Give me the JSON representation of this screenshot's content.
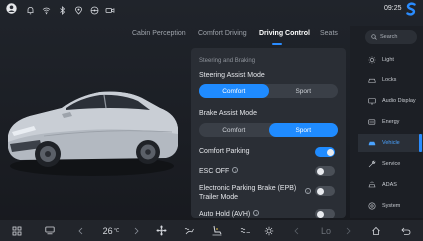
{
  "status": {
    "time": "09:25"
  },
  "tabs": [
    {
      "label": "Cabin Perception"
    },
    {
      "label": "Comfort Driving"
    },
    {
      "label": "Driving Control"
    },
    {
      "label": "Seats"
    }
  ],
  "panel": {
    "section": "Steering and Braking",
    "steering": {
      "label": "Steering Assist Mode",
      "options": [
        "Comfort",
        "Sport"
      ],
      "selected": "Comfort"
    },
    "brake": {
      "label": "Brake Assist Mode",
      "options": [
        "Comfort",
        "Sport"
      ],
      "selected": "Sport"
    },
    "comfort_parking": {
      "label": "Comfort Parking",
      "on": true
    },
    "esc_off": {
      "label": "ESC OFF",
      "on": false
    },
    "epb": {
      "label_line1": "Electronic Parking Brake (EPB)",
      "label_line2": "Trailer Mode",
      "on": false
    },
    "avh": {
      "label": "Auto Hold (AVH)",
      "on": false
    }
  },
  "sidebar": {
    "search_placeholder": "Search",
    "items": [
      {
        "label": "Light",
        "icon": "sun-icon"
      },
      {
        "label": "Locks",
        "icon": "car-lock-icon"
      },
      {
        "label": "Audio Display",
        "icon": "audio-display-icon"
      },
      {
        "label": "Energy",
        "icon": "energy-icon"
      },
      {
        "label": "Vehicle",
        "icon": "vehicle-icon",
        "active": true
      },
      {
        "label": "Service",
        "icon": "service-icon"
      },
      {
        "label": "ADAS",
        "icon": "adas-icon"
      },
      {
        "label": "System",
        "icon": "system-icon"
      }
    ]
  },
  "dock": {
    "temp_left": "26",
    "temp_unit": "℃",
    "temp_right": "Lo"
  },
  "colors": {
    "accent": "#1f8bff",
    "panel_bg": "#2a2e35",
    "background": "#1b1e24"
  }
}
